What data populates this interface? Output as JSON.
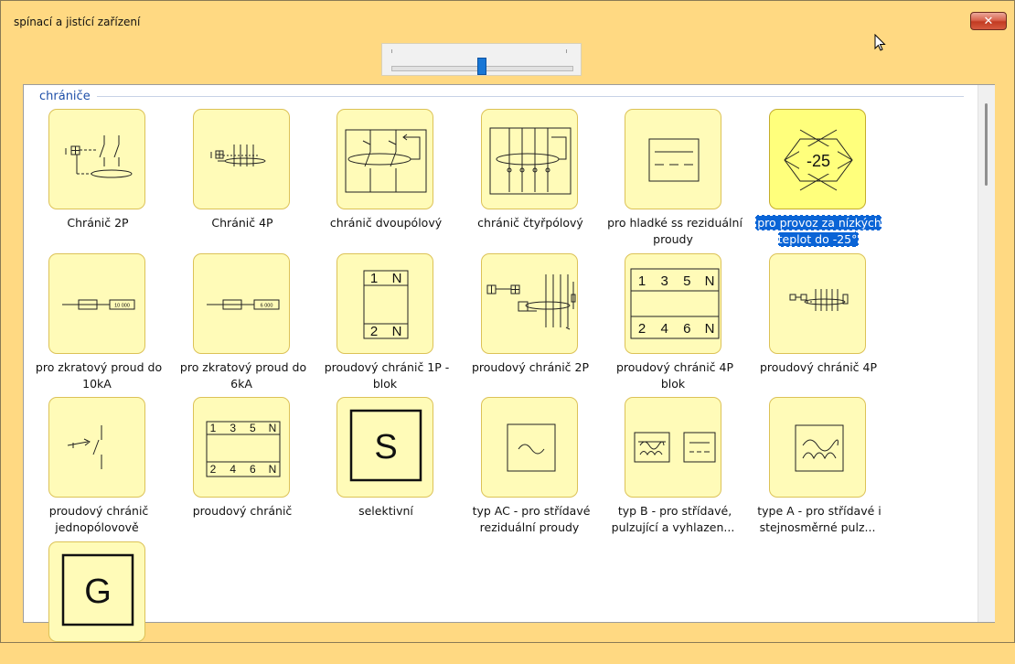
{
  "window": {
    "title": "spínací a jistící zařízení",
    "close_glyph": "✕"
  },
  "slider": {
    "level_fraction": 0.5
  },
  "group": {
    "label": "chrániče"
  },
  "items": [
    {
      "label": "Chránič 2P",
      "icon": "rcd-2p-symbol-icon"
    },
    {
      "label": "Chránič 4P",
      "icon": "rcd-4p-symbol-icon"
    },
    {
      "label": "chránič dvoupólový",
      "icon": "rcd-two-pole-icon"
    },
    {
      "label": "chránič čtyřpólový",
      "icon": "rcd-four-pole-icon"
    },
    {
      "label": "pro hladké ss reziduální proudy",
      "icon": "smooth-dc-icon"
    },
    {
      "label": "pro provoz za nízkých teplot do -25°",
      "icon": "low-temperature-icon",
      "symbol_text": "-25",
      "selected": true
    },
    {
      "label": "pro zkratový proud do 10kA",
      "icon": "short-circuit-10ka-icon",
      "symbol_text": "10 000"
    },
    {
      "label": "pro zkratový proud do 6kA",
      "icon": "short-circuit-6ka-icon",
      "symbol_text": "6 000"
    },
    {
      "label": "proudový chránič 1P - blok",
      "icon": "rcd-1p-block-icon",
      "top_row": "1 N",
      "bottom_row": "2 N"
    },
    {
      "label": "proudový chránič 2P",
      "icon": "rcd-2p-detail-icon"
    },
    {
      "label": "proudový chránič 4P blok",
      "icon": "rcd-4p-block-icon",
      "top_row": "1 3 5 N",
      "bottom_row": "2 4 6 N"
    },
    {
      "label": "proudový chránič 4P",
      "icon": "rcd-4p-small-icon"
    },
    {
      "label": "proudový chránič jednopólovově",
      "icon": "rcd-single-pole-icon"
    },
    {
      "label": "proudový chránič",
      "icon": "rcd-block-icon",
      "top_row": "1 3 5 N",
      "bottom_row": "2 4 6 N"
    },
    {
      "label": "selektivní",
      "icon": "selective-s-icon",
      "symbol_text": "S"
    },
    {
      "label": "typ AC - pro střídavé reziduální proudy",
      "icon": "type-ac-icon"
    },
    {
      "label": "typ B - pro střídavé, pulzující a vyhlazen...",
      "icon": "type-b-icon"
    },
    {
      "label": "type A - pro střídavé i stejnosměrné pulz...",
      "icon": "type-a-icon"
    },
    {
      "label": "",
      "icon": "g-symbol-icon",
      "symbol_text": "G"
    }
  ]
}
